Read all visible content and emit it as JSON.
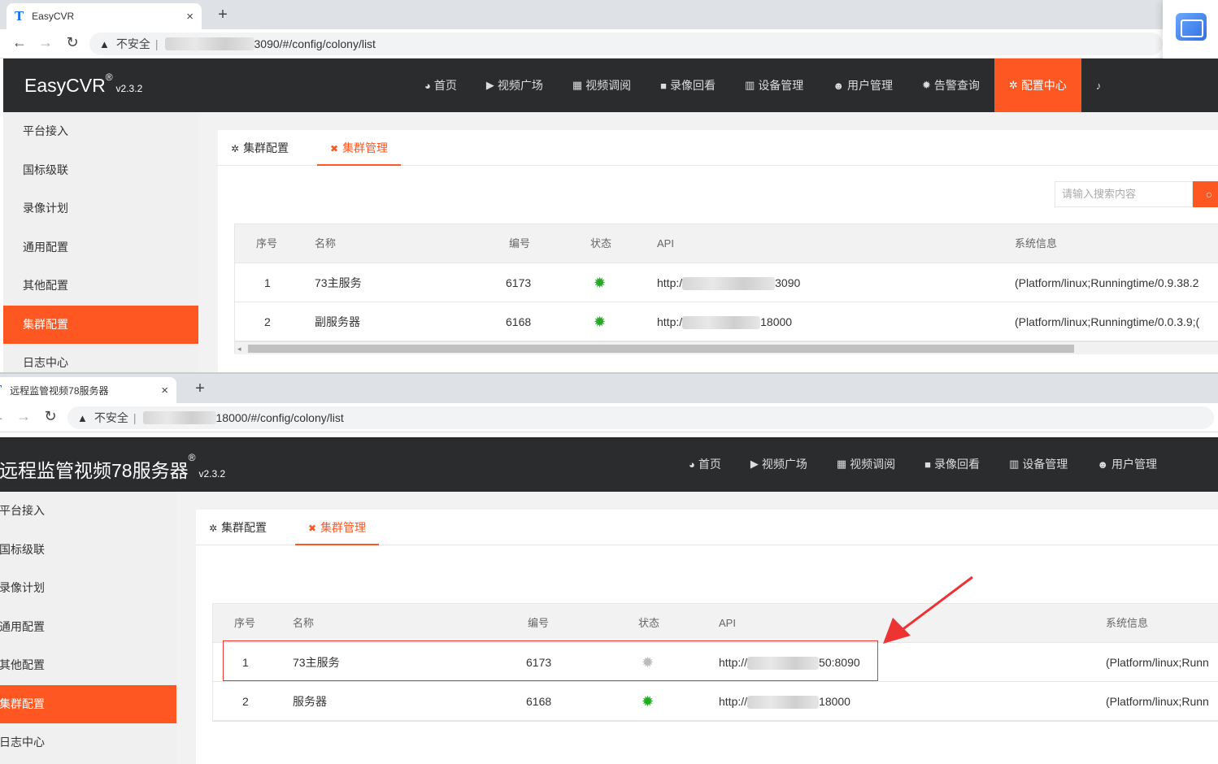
{
  "screenshot1": {
    "browser": {
      "tab_title": "EasyCVR",
      "tab_close": "×",
      "new_tab": "+",
      "back": "←",
      "forward": "→",
      "reload": "↻",
      "warn_icon": "▲",
      "insecure_label": "不安全",
      "url_visible": "3090/#/config/colony/list"
    },
    "app": {
      "logo": "EasyCVR",
      "logo_mark": "®",
      "version": "v2.3.2",
      "nav": [
        {
          "icon": "dashboard-icon",
          "glyph": "◕",
          "label": "首页"
        },
        {
          "icon": "play-icon",
          "glyph": "▶",
          "label": "视频广场"
        },
        {
          "icon": "grid-icon",
          "glyph": "▦",
          "label": "视频调阅"
        },
        {
          "icon": "camera-icon",
          "glyph": "■",
          "label": "录像回看"
        },
        {
          "icon": "device-icon",
          "glyph": "▥",
          "label": "设备管理"
        },
        {
          "icon": "user-icon",
          "glyph": "☻",
          "label": "用户管理"
        },
        {
          "icon": "alarm-icon",
          "glyph": "✹",
          "label": "告警查询"
        },
        {
          "icon": "gear-icon",
          "glyph": "✲",
          "label": "配置中心",
          "active": true
        },
        {
          "icon": "bell-icon",
          "glyph": "♪",
          "label": ""
        }
      ],
      "sidebar": [
        "平台接入",
        "国标级联",
        "录像计划",
        "通用配置",
        "其他配置",
        "集群配置",
        "日志中心"
      ],
      "sidebar_active": 5,
      "tabs": [
        {
          "icon": "gear-icon",
          "glyph": "✲",
          "label": "集群配置"
        },
        {
          "icon": "tools-icon",
          "glyph": "✖",
          "label": "集群管理",
          "active": true
        }
      ],
      "search_placeholder": "请输入搜索内容",
      "search_glyph": "○",
      "table": {
        "headers": [
          "序号",
          "名称",
          "编号",
          "状态",
          "API",
          "系统信息"
        ],
        "rows": [
          {
            "index": "1",
            "name": "73主服务",
            "code": "6173",
            "status": "online",
            "api_prefix": "http:/",
            "api_suffix": "3090",
            "sysinfo": "(Platform/linux;Runningtime/0.9.38.2"
          },
          {
            "index": "2",
            "name": "副服务器",
            "code": "6168",
            "status": "online",
            "api_prefix": "http:/",
            "api_suffix": "18000",
            "sysinfo": "(Platform/linux;Runningtime/0.0.3.9;("
          }
        ]
      },
      "scroll_arrow": "◂"
    }
  },
  "screenshot2": {
    "browser": {
      "tab_title": "远程监管视频78服务器",
      "tab_close": "×",
      "new_tab": "+",
      "back": "←",
      "forward": "→",
      "reload": "↻",
      "warn_icon": "▲",
      "insecure_label": "不安全",
      "url_visible": "18000/#/config/colony/list"
    },
    "app": {
      "logo": "远程监管视频78服务器",
      "logo_mark": "®",
      "version": "v2.3.2",
      "nav": [
        {
          "icon": "dashboard-icon",
          "glyph": "◕",
          "label": "首页"
        },
        {
          "icon": "play-icon",
          "glyph": "▶",
          "label": "视频广场"
        },
        {
          "icon": "grid-icon",
          "glyph": "▦",
          "label": "视频调阅"
        },
        {
          "icon": "camera-icon",
          "glyph": "■",
          "label": "录像回看"
        },
        {
          "icon": "device-icon",
          "glyph": "▥",
          "label": "设备管理"
        },
        {
          "icon": "user-icon",
          "glyph": "☻",
          "label": "用户管理"
        }
      ],
      "sidebar": [
        "平台接入",
        "国标级联",
        "录像计划",
        "通用配置",
        "其他配置",
        "集群配置",
        "日志中心"
      ],
      "sidebar_active": 5,
      "tabs": [
        {
          "icon": "gear-icon",
          "glyph": "✲",
          "label": "集群配置"
        },
        {
          "icon": "tools-icon",
          "glyph": "✖",
          "label": "集群管理",
          "active": true
        }
      ],
      "table": {
        "headers": [
          "序号",
          "名称",
          "编号",
          "状态",
          "API",
          "系统信息"
        ],
        "rows": [
          {
            "index": "1",
            "name": "73主服务",
            "code": "6173",
            "status": "offline",
            "api_prefix": "http://",
            "api_suffix": "50:8090",
            "sysinfo": "(Platform/linux;Runn"
          },
          {
            "index": "2",
            "name": "服务器",
            "code": "6168",
            "status": "online",
            "api_prefix": "http://",
            "api_suffix": "18000",
            "sysinfo": "(Platform/linux;Runn"
          }
        ]
      }
    }
  },
  "status_glyph": "✹",
  "colors": {
    "accent": "#ff5722",
    "header_bg": "#2b2c2e",
    "online": "#22aa22",
    "offline": "#bbbbbb",
    "annotation": "#e33333"
  }
}
